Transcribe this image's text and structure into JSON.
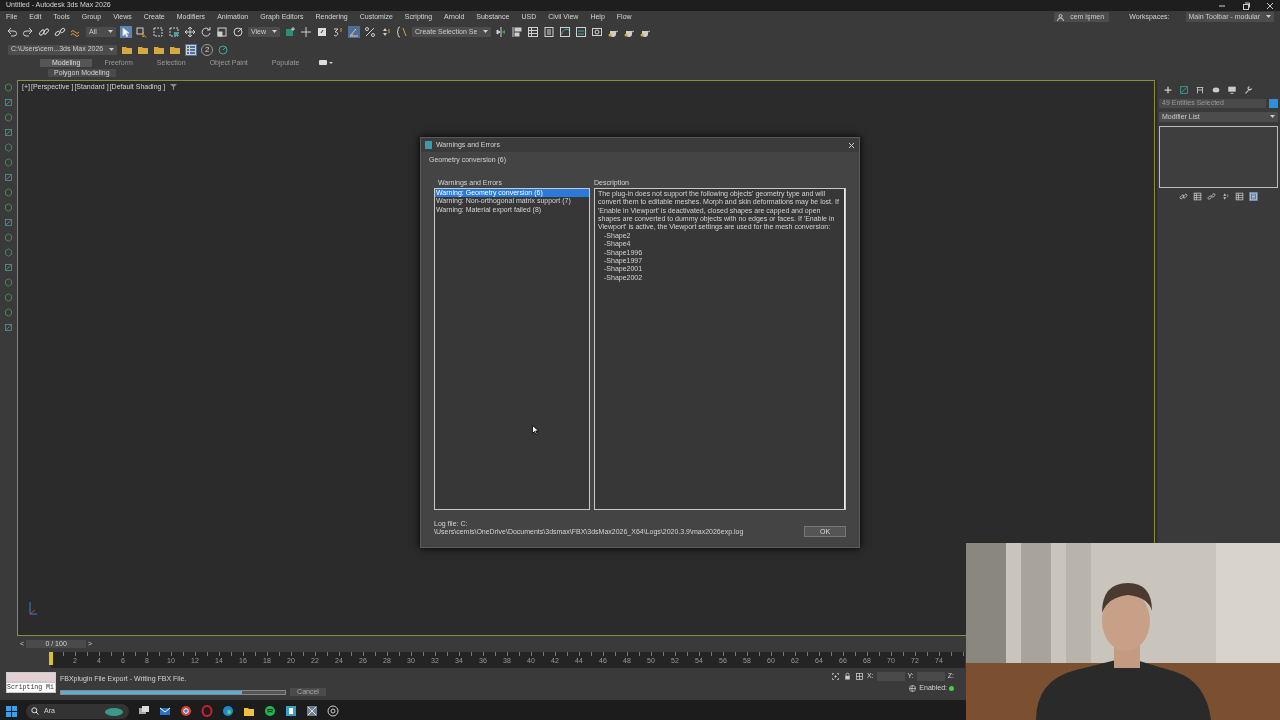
{
  "window": {
    "title": "Untitled - Autodesk 3ds Max 2026"
  },
  "menu": [
    "File",
    "Edit",
    "Tools",
    "Group",
    "Views",
    "Create",
    "Modifiers",
    "Animation",
    "Graph Editors",
    "Rendering",
    "Customize",
    "Scripting",
    "Arnold",
    "Substance",
    "USD",
    "Civil View",
    "Help",
    "Flow"
  ],
  "account": {
    "user": "cem işmen",
    "workspaces_label": "Workspaces:",
    "workspace": "Main Toolbar - modular"
  },
  "toolbar": {
    "selection_filter": "All",
    "reference_coord": "View",
    "named_selection": "Create Selection Se"
  },
  "project": {
    "path": "C:\\Users\\cem...3ds Max 2026",
    "badge": "2"
  },
  "ribbon": {
    "tabs": [
      {
        "label": "Modeling",
        "selected": true
      },
      {
        "label": "Freeform",
        "selected": false
      },
      {
        "label": "Selection",
        "selected": false
      },
      {
        "label": "Object Paint",
        "selected": false
      },
      {
        "label": "Populate",
        "selected": false
      }
    ],
    "panel": "Polygon Modeling"
  },
  "viewport": {
    "labels": [
      "[+]",
      "[Perspective ]",
      "[Standard ]",
      "[Default Shading ]"
    ]
  },
  "command_panel": {
    "selection": "49 Entities Selected",
    "modifier_list": "Modifier List"
  },
  "dialog": {
    "title": "Warnings and Errors",
    "group": "Geometry conversion (6)",
    "list_label": "Warnings and Errors",
    "items": [
      {
        "label": "Warning: Geometry conversion (6)",
        "selected": true
      },
      {
        "label": "Warning: Non-orthogonal matrix support (7)",
        "selected": false
      },
      {
        "label": "Warning: Material export failed (8)",
        "selected": false
      }
    ],
    "description_label": "Description",
    "description": "The plug-in does not support the following objects' geometry type and will convert them to editable meshes. Morph and skin deformations may be lost. If 'Enable in Viewport' is deactivated, closed shapes are capped and open shapes are converted to dummy objects with no edges or faces. If 'Enable in Viewport' is active, the Viewport settings are used for the mesh conversion:",
    "objects": [
      "-Shape2",
      "-Shape4",
      "-Shape1996",
      "-Shape1997",
      "-Shape2001",
      "-Shape2002"
    ],
    "log_label": "Log file: C:",
    "log_path": "\\Users\\cemis\\OneDrive\\Documents\\3dsmax\\FBX\\3dsMax2026_X64\\Logs\\2020.3.9\\max2026exp.log",
    "ok": "OK"
  },
  "timeline": {
    "prev": "<",
    "slider": "0 / 100",
    "next": ">",
    "ticks": [
      "2",
      "4",
      "6",
      "8",
      "10",
      "12",
      "14",
      "16",
      "18",
      "20",
      "22",
      "24",
      "26",
      "28",
      "30",
      "32",
      "34",
      "36",
      "38",
      "40",
      "42",
      "44",
      "46",
      "48",
      "50",
      "52",
      "54",
      "56",
      "58",
      "60",
      "62",
      "64",
      "66",
      "68",
      "70",
      "72",
      "74"
    ]
  },
  "status": {
    "listener": "Scripting Mi",
    "message": "FBXplugin File Export  -  Writing FBX File.",
    "progress": {
      "level": 0.81
    },
    "cancel": "Cancel",
    "x_label": "X:",
    "y_label": "Y:",
    "z_label": "Z:",
    "enabled_label": "Enabled:",
    "enabled": true
  },
  "taskbar": {
    "search": "Ara"
  }
}
